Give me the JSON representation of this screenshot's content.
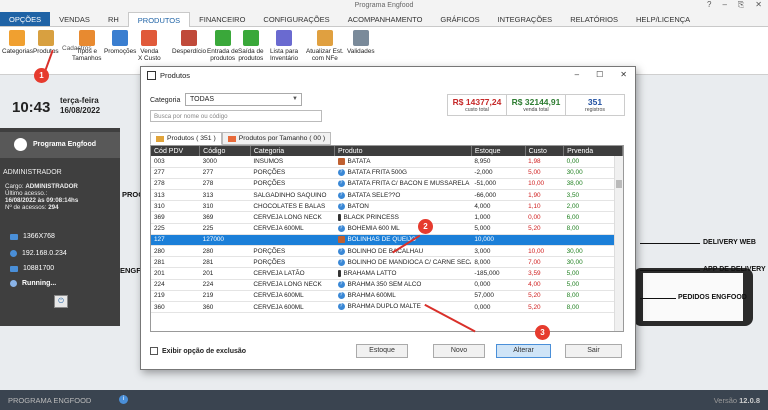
{
  "app": {
    "title": "Programa Engfood",
    "window_controls": [
      "?",
      "–",
      "⎘",
      "✕"
    ]
  },
  "ribbon_tabs": [
    "OPÇÕES",
    "VENDAS",
    "RH",
    "PRODUTOS",
    "FINANCEIRO",
    "CONFIGURAÇÕES",
    "ACOMPANHAMENTO",
    "GRÁFICOS",
    "INTEGRAÇÕES",
    "RELATÓRIOS",
    "HELP/LICENÇA"
  ],
  "ribbon_active": "PRODUTOS",
  "ribbon_buttons": [
    {
      "label": "Categorias",
      "icon": "categories-icon",
      "color": "#f0a030"
    },
    {
      "label": "Produtos",
      "icon": "products-icon",
      "color": "#d8a040"
    },
    {
      "label": "Tipos e\nTamanhos",
      "icon": "sizes-icon",
      "color": "#e88a30"
    },
    {
      "label": "Promoções",
      "icon": "promotions-icon",
      "color": "#3a7ed0"
    },
    {
      "label": "Venda\nX Custo",
      "icon": "sale-cost-icon",
      "color": "#e05a3a"
    },
    {
      "label": "Desperdício",
      "icon": "waste-icon",
      "color": "#c04a3a"
    },
    {
      "label": "Entrada de\nprodutos",
      "icon": "product-entry-icon",
      "color": "#3aa83a"
    },
    {
      "label": "Saída de\nprodutos",
      "icon": "product-exit-icon",
      "color": "#3aa83a"
    },
    {
      "label": "Lista para\nInventário",
      "icon": "inventory-list-icon",
      "color": "#6a6ad0"
    },
    {
      "label": "Atualizar Est.\ncom NFe",
      "icon": "update-stock-nfe-icon",
      "color": "#e0a040"
    },
    {
      "label": "Validades",
      "icon": "validity-search-icon",
      "color": "#7a8a9a"
    }
  ],
  "ribbon_group_label": "Cadastros",
  "left_panel": {
    "time": "10:43",
    "weekday": "terça-feira",
    "date": "16/08/2022",
    "brand": "Programa Engfood",
    "user": "ADMINISTRADOR",
    "cargo_label": "Cargo:",
    "cargo": "ADMINISTRADOR",
    "last_access_label": "Último acesso.:",
    "last_access": "16/08/2022 às 09:08:14hs",
    "access_count_label": "Nº de acessos:",
    "access_count": "294",
    "resolution": "1366X768",
    "ip": "192.168.0.234",
    "code": "10881700",
    "status": "Running..."
  },
  "background": {
    "word1": "PROGI",
    "word2": "ENGFO",
    "delivery_web": "DELIVERY WEB",
    "app_delivery": "APP DE DELIVERY",
    "pedidos": "PEDIDOS ENGFOOD"
  },
  "dialog": {
    "title": "Produtos",
    "controls": [
      "–",
      "☐",
      "✕"
    ],
    "category_label": "Categoria",
    "category_value": "TODAS",
    "search_placeholder": "Busca por nome ou código",
    "totals": [
      {
        "value": "R$ 14377,24",
        "label": "custo total",
        "color": "#c62828"
      },
      {
        "value": "R$ 32144,91",
        "label": "venda total",
        "color": "#2e7d32"
      },
      {
        "value": "351",
        "label": "registros",
        "color": "#1f4fa0"
      }
    ],
    "subtabs": [
      "Produtos ( 351 )",
      "Produtos por Tamanho ( 00 )"
    ],
    "columns": [
      "Cód PDV",
      "Código",
      "Categoria",
      "Produto",
      "Estoque",
      "Custo",
      "Prvenda"
    ],
    "rows": [
      [
        "003",
        "3000",
        "INSUMOS",
        "BATATA",
        "8,950",
        "1,98",
        "0,00",
        "img"
      ],
      [
        "277",
        "277",
        "PORÇÕES",
        "BATATA FRITA 500G",
        "-2,000",
        "5,00",
        "30,00",
        "q"
      ],
      [
        "278",
        "278",
        "PORÇÕES",
        "BATATA FRITA C/ BACON E MUSSARELA",
        "-51,000",
        "10,00",
        "38,00",
        "q"
      ],
      [
        "313",
        "313",
        "SALGADINHO SAQUINO",
        "BATATA SELE??O",
        "-66,000",
        "1,90",
        "3,50",
        "q"
      ],
      [
        "310",
        "310",
        "CHOCOLATES E BALAS",
        "BATON",
        "4,000",
        "1,10",
        "2,00",
        "q"
      ],
      [
        "369",
        "369",
        "CERVEJA LONG NECK",
        "BLACK PRINCESS",
        "1,000",
        "0,00",
        "6,00",
        "bottle"
      ],
      [
        "225",
        "225",
        "CERVEJA 600ML",
        "BOHEMIA 600 ML",
        "5,000",
        "5,20",
        "8,00",
        "q"
      ],
      [
        "127",
        "127000",
        "",
        "BOLINHAS DE QUEIJO",
        "10,000",
        "",
        "",
        "img"
      ],
      [
        "280",
        "280",
        "PORÇÕES",
        "BOLINHO DE BACALHAU",
        "3,000",
        "10,00",
        "30,00",
        "q"
      ],
      [
        "281",
        "281",
        "PORÇÕES",
        "BOLINHO DE MANDIOCA C/ CARNE SECA",
        "8,000",
        "7,00",
        "30,00",
        "q"
      ],
      [
        "201",
        "201",
        "CERVEJA LATÃO",
        "BRAHAMA LATTO",
        "-185,000",
        "3,59",
        "5,00",
        "bottle"
      ],
      [
        "224",
        "224",
        "CERVEJA LONG NECK",
        "BRAHMA 350 SEM ALCO",
        "0,000",
        "4,00",
        "5,00",
        "q"
      ],
      [
        "219",
        "219",
        "CERVEJA 600ML",
        "BRAHMA 600ML",
        "57,000",
        "5,20",
        "8,00",
        "q"
      ],
      [
        "360",
        "360",
        "CERVEJA 600ML",
        "BRAHMA DUPLO MALTE",
        "0,000",
        "5,20",
        "8,00",
        "q"
      ]
    ],
    "selected_row_index": 7,
    "show_deleted_label": "Exibir opção de exclusão",
    "buttons": [
      "Estoque",
      "Novo",
      "Alterar",
      "Sair"
    ]
  },
  "annotations": [
    "1",
    "2",
    "3"
  ],
  "bottom_bar": {
    "brand": "PROGRAMA ENGFOOD",
    "info": "i",
    "version_label": "Versão",
    "version": "12.0.8"
  }
}
